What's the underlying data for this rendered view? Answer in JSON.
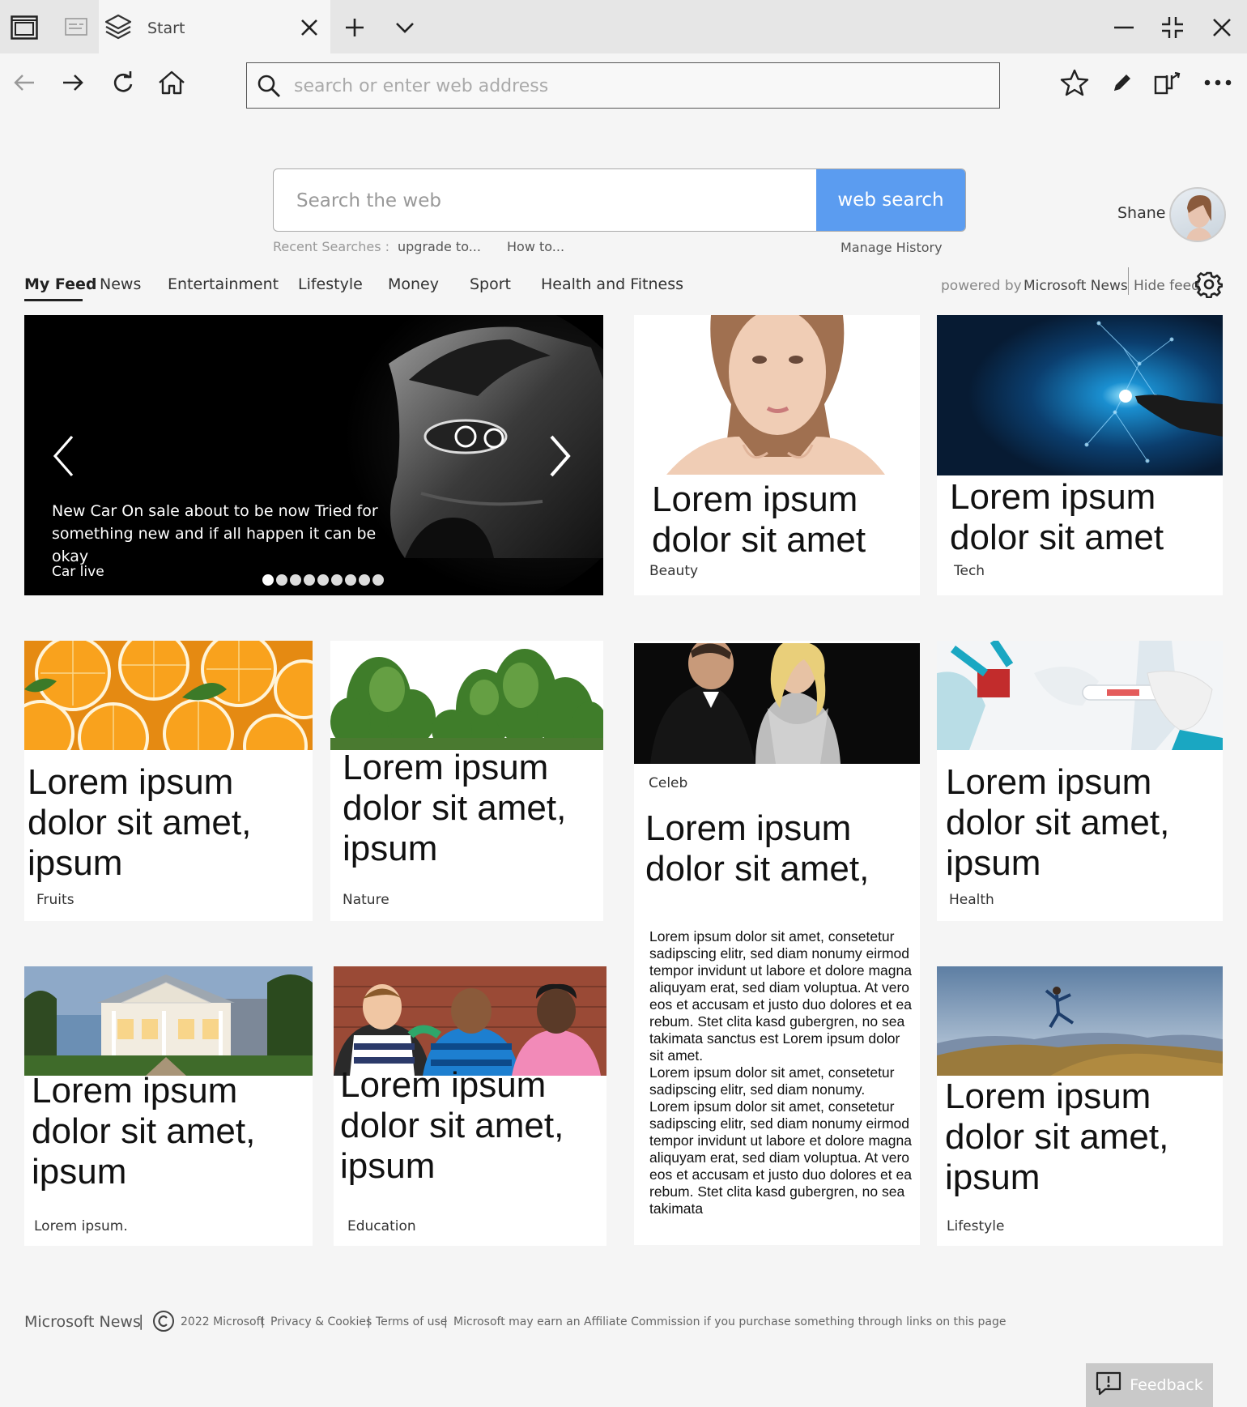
{
  "browser": {
    "tab_title": "Start",
    "address_placeholder": "search or enter web address"
  },
  "search": {
    "placeholder": "Search the web",
    "button_label": "web search",
    "recent_label": "Recent Searches :",
    "recent_items": [
      "upgrade to...",
      "How to..."
    ],
    "manage_history": "Manage History"
  },
  "profile": {
    "name": "Shane"
  },
  "feed": {
    "tabs": [
      "My Feed",
      "News",
      "Entertainment",
      "Lifestyle",
      "Money",
      "Sport",
      "Health and Fitness"
    ],
    "active_tab": "My Feed",
    "powered_by": "powered by",
    "provider": "Microsoft News",
    "hide_feed": "Hide feed"
  },
  "hero": {
    "caption": "New Car On sale about to be now Tried for something new and if all happen it can be okay",
    "source": "Car live",
    "slide_count": 9,
    "active_slide": 1
  },
  "cards": {
    "beauty": {
      "headline": "Lorem ipsum dolor sit amet",
      "category": "Beauty"
    },
    "tech": {
      "headline": "Lorem ipsum dolor sit amet",
      "category": "Tech"
    },
    "fruits": {
      "headline": "Lorem ipsum dolor sit amet, ipsum",
      "category": "Fruits"
    },
    "nature": {
      "headline": "Lorem ipsum dolor sit amet, ipsum",
      "category": "Nature"
    },
    "celeb": {
      "category": "Celeb",
      "headline": "Lorem ipsum dolor sit amet,",
      "body": "Lorem ipsum dolor sit amet, consetetur sadipscing elitr, sed diam nonumy eirmod tempor invidunt ut labore et dolore magna aliquyam erat, sed diam voluptua. At vero eos et accusam et justo duo dolores et ea rebum. Stet clita kasd gubergren, no sea takimata sanctus est Lorem ipsum dolor sit amet.\nLorem ipsum dolor sit amet, consetetur sadipscing elitr, sed diam nonumy.\nLorem ipsum dolor sit amet, consetetur sadipscing elitr, sed diam nonumy eirmod tempor invidunt ut labore et dolore magna aliquyam erat, sed diam voluptua. At vero eos et accusam et justo duo dolores et ea rebum. Stet clita kasd gubergren, no sea takimata"
    },
    "health": {
      "headline": "Lorem ipsum dolor sit amet, ipsum",
      "category": "Health"
    },
    "house": {
      "headline": "Lorem ipsum dolor sit amet, ipsum",
      "category": "Lorem ipsum."
    },
    "education": {
      "headline": "Lorem ipsum dolor sit amet, ipsum",
      "category": "Education"
    },
    "lifestyle": {
      "headline": "Lorem ipsum dolor sit amet, ipsum",
      "category": "Lifestyle"
    }
  },
  "footer": {
    "brand": "Microsoft News",
    "copyright": "2022 Microsoft",
    "privacy": "Privacy & Cookies",
    "terms": "Terms of use",
    "affiliate": "Microsoft may earn an Affiliate Commission if you purchase something through links on this page"
  },
  "feedback": {
    "label": "Feedback"
  }
}
